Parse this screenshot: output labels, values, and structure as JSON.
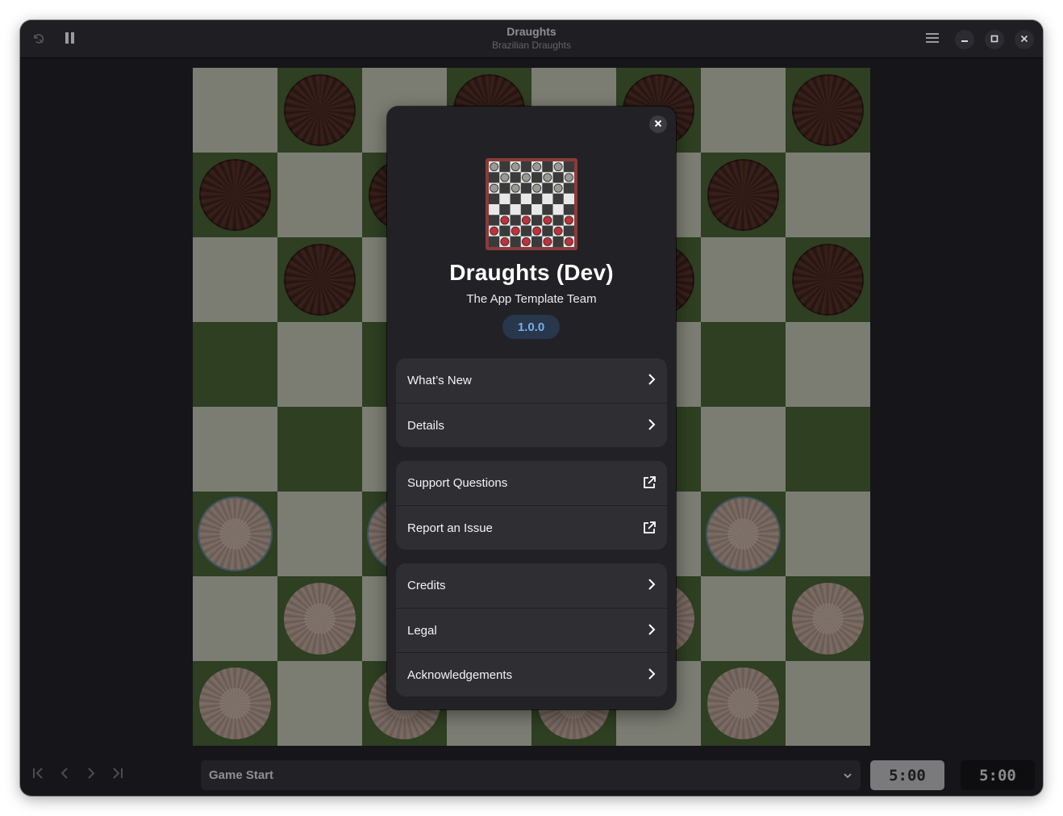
{
  "window": {
    "title": "Draughts",
    "subtitle": "Brazilian Draughts"
  },
  "headerbar": {
    "left_icons": [
      "undo-icon",
      "pause-icon"
    ],
    "right_icons": [
      "menu-icon",
      "minimize-icon",
      "maximize-icon",
      "close-icon"
    ]
  },
  "board": {
    "size": 8,
    "colors": {
      "light": "#7b7d73",
      "dark": "#2e3f22"
    },
    "pieces_black": [
      [
        0,
        1
      ],
      [
        0,
        3
      ],
      [
        0,
        5
      ],
      [
        0,
        7
      ],
      [
        1,
        0
      ],
      [
        1,
        2
      ],
      [
        1,
        4
      ],
      [
        1,
        6
      ],
      [
        2,
        1
      ],
      [
        2,
        3
      ],
      [
        2,
        5
      ],
      [
        2,
        7
      ]
    ],
    "pieces_white": [
      [
        5,
        0
      ],
      [
        5,
        2
      ],
      [
        5,
        4
      ],
      [
        5,
        6
      ],
      [
        6,
        1
      ],
      [
        6,
        3
      ],
      [
        6,
        5
      ],
      [
        6,
        7
      ],
      [
        7,
        0
      ],
      [
        7,
        2
      ],
      [
        7,
        4
      ],
      [
        7,
        6
      ]
    ],
    "movable_white": [
      [
        5,
        0
      ],
      [
        5,
        2
      ],
      [
        5,
        6
      ]
    ]
  },
  "controls": {
    "nav_icons": [
      "go-first-icon",
      "go-previous-icon",
      "go-next-icon",
      "go-last-icon"
    ],
    "move_select": "Game Start",
    "clock_white": "5:00",
    "clock_black": "5:00"
  },
  "about": {
    "app_name": "Draughts (Dev)",
    "developer": "The App Template Team",
    "version": "1.0.0",
    "groups": [
      {
        "rows": [
          {
            "label": "What’s New",
            "icon": "chevron-right-icon"
          },
          {
            "label": "Details",
            "icon": "chevron-right-icon"
          }
        ]
      },
      {
        "rows": [
          {
            "label": "Support Questions",
            "icon": "external-link-icon"
          },
          {
            "label": "Report an Issue",
            "icon": "external-link-icon"
          }
        ]
      },
      {
        "rows": [
          {
            "label": "Credits",
            "icon": "chevron-right-icon"
          },
          {
            "label": "Legal",
            "icon": "chevron-right-icon"
          },
          {
            "label": "Acknowledgements",
            "icon": "chevron-right-icon"
          }
        ]
      }
    ],
    "accent_color": "#78aeed"
  }
}
